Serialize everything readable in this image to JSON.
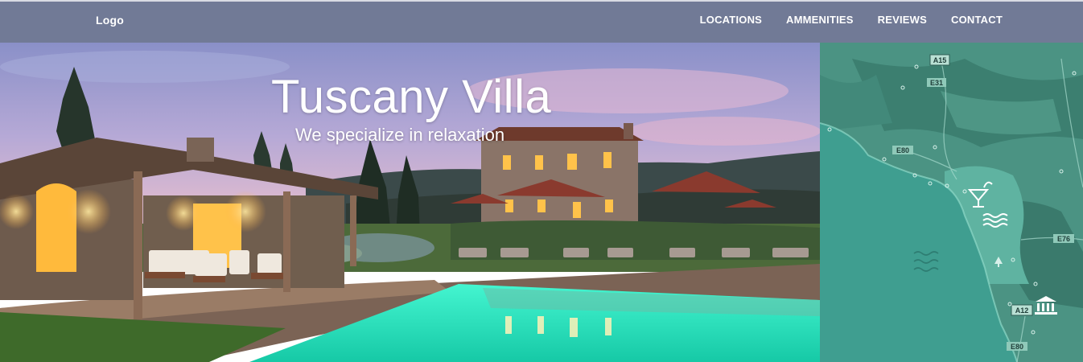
{
  "navbar": {
    "logo": "Logo",
    "links": [
      "LOCATIONS",
      "AMMENITIES",
      "REVIEWS",
      "CONTACT"
    ]
  },
  "hero": {
    "title": "Tuscany Villa",
    "subtitle": "We specialize in relaxation"
  },
  "map": {
    "road_labels": [
      "A15",
      "E31",
      "E80",
      "E76",
      "A12",
      "E80"
    ],
    "icons": [
      "cocktail-icon",
      "waves-icon",
      "museum-icon",
      "tree-icon"
    ]
  },
  "colors": {
    "navbar": "#717a96",
    "map_land": "#4b9383",
    "map_sea": "#3f9e90",
    "pool": "#2ff0c8"
  }
}
